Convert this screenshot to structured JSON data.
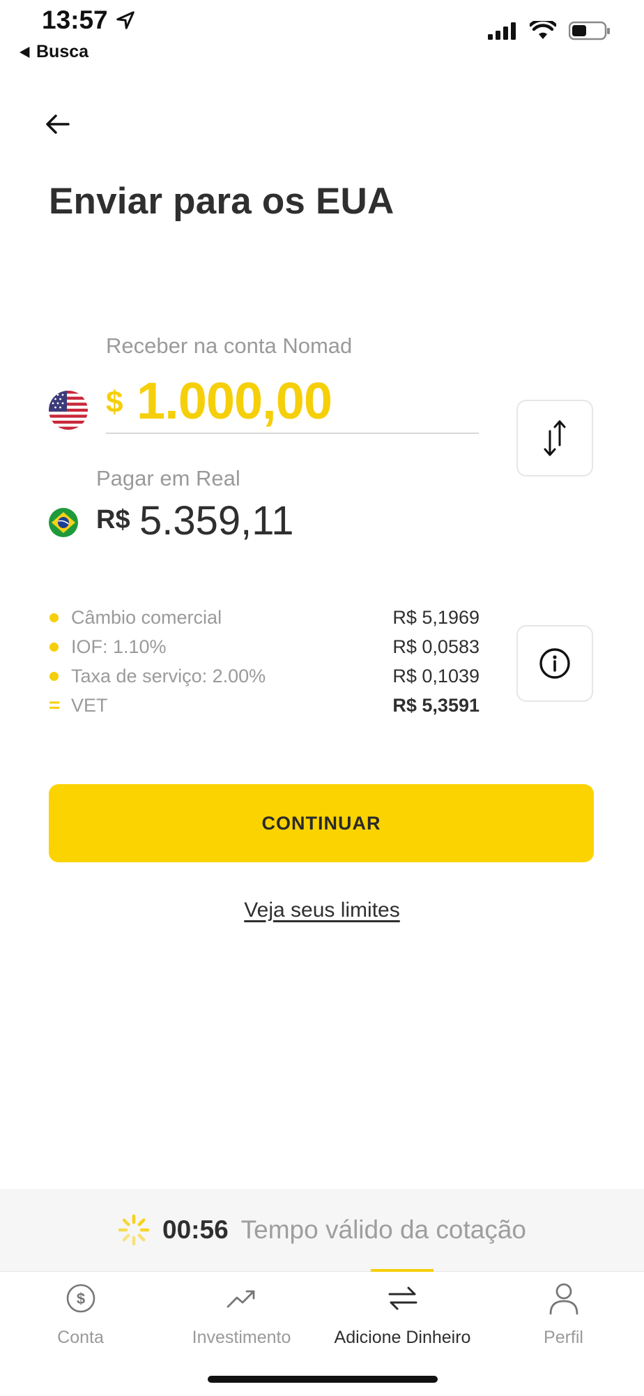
{
  "status_bar": {
    "time": "13:57",
    "back_app": "Busca"
  },
  "header": {
    "title": "Enviar para os EUA"
  },
  "receive": {
    "label": "Receber na conta Nomad",
    "currency_symbol": "$",
    "amount": "1.000,00",
    "flag": "us-flag-icon"
  },
  "pay": {
    "label": "Pagar em Real",
    "currency_symbol": "R$",
    "amount": "5.359,11",
    "flag": "br-flag-icon"
  },
  "breakdown": [
    {
      "label": "Câmbio comercial",
      "value": "R$ 5,1969"
    },
    {
      "label": "IOF: 1.10%",
      "value": "R$ 0,0583"
    },
    {
      "label": "Taxa de serviço: 2.00%",
      "value": "R$ 0,1039"
    },
    {
      "marker": "=",
      "label": "VET",
      "value": "R$ 5,3591"
    }
  ],
  "actions": {
    "continue_label": "CONTINUAR",
    "limits_link": "Veja seus limites"
  },
  "quote_timer": {
    "time": "00:56",
    "label": "Tempo válido da cotação"
  },
  "tabs": [
    {
      "label": "Conta",
      "icon": "dollar-circle-icon"
    },
    {
      "label": "Investimento",
      "icon": "trend-up-icon"
    },
    {
      "label": "Adicione Dinheiro",
      "icon": "transfer-arrows-icon",
      "active": true
    },
    {
      "label": "Perfil",
      "icon": "user-icon"
    }
  ],
  "colors": {
    "accent": "#fbd300",
    "amount_yellow": "#f5cf0a",
    "text_dark": "#2f2f2f",
    "text_muted": "#9a9a9a"
  }
}
